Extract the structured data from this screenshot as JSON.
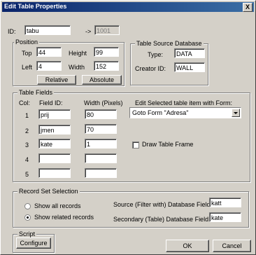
{
  "window": {
    "title": "Edit Table Properties",
    "close_label": "X"
  },
  "id_row": {
    "label": "ID:",
    "value": "tabu",
    "arrow": "->",
    "mapped": "1001"
  },
  "position": {
    "title": "Position",
    "top_label": "Top",
    "top_value": "44",
    "height_label": "Height",
    "height_value": "99",
    "left_label": "Left",
    "left_value": "4",
    "width_label": "Width",
    "width_value": "152",
    "relative_label": "Relative",
    "absolute_label": "Absolute"
  },
  "source_db": {
    "title": "Table Source Database",
    "type_label": "Type:",
    "type_value": "DATA",
    "creator_label": "Creator ID:",
    "creator_value": "WALL"
  },
  "fields": {
    "title": "Table Fields",
    "col_header": "Col:",
    "field_id_header": "Field ID:",
    "width_header": "Width (Pixels)",
    "edit_header": "Edit  Selected table item with Form:",
    "rows": [
      {
        "col": "1",
        "field": "prij",
        "width": "80"
      },
      {
        "col": "2",
        "field": "jmen",
        "width": "70"
      },
      {
        "col": "3",
        "field": "kate",
        "width": "1"
      },
      {
        "col": "4",
        "field": "",
        "width": ""
      },
      {
        "col": "5",
        "field": "",
        "width": ""
      }
    ],
    "form_select": "Goto Form \"Adresa\"",
    "draw_frame_label": "Draw Table Frame"
  },
  "record_set": {
    "title": "Record Set Selection",
    "show_all_label": "Show all records",
    "show_related_label": "Show related records",
    "selected": "show_related",
    "source_label": "Source (Filter with) Database Field:",
    "source_value": "katt",
    "secondary_label": "Secondary (Table) Database Field:",
    "secondary_value": "kate"
  },
  "script": {
    "title": "Script",
    "configure_label": "Configure"
  },
  "footer": {
    "ok_label": "OK",
    "cancel_label": "Cancel"
  }
}
